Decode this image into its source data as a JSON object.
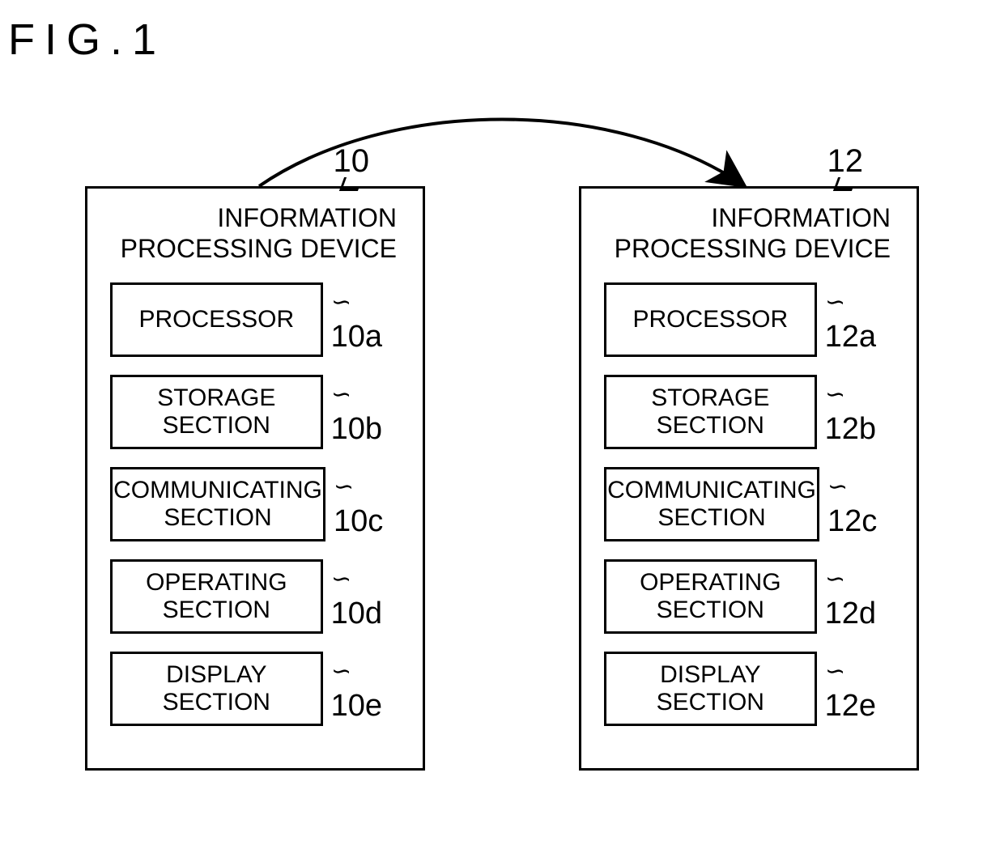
{
  "figure_title": "FIG.1",
  "arrow": {
    "from": "device-10",
    "to": "device-12"
  },
  "devices": [
    {
      "id": "device-10",
      "ref": "10",
      "title_line1": "INFORMATION",
      "title_line2": "PROCESSING DEVICE",
      "components": [
        {
          "label": "PROCESSOR",
          "ref": "10a"
        },
        {
          "label": "STORAGE SECTION",
          "ref": "10b"
        },
        {
          "label": "COMMUNICATING SECTION",
          "ref": "10c"
        },
        {
          "label": "OPERATING SECTION",
          "ref": "10d"
        },
        {
          "label": "DISPLAY SECTION",
          "ref": "10e"
        }
      ]
    },
    {
      "id": "device-12",
      "ref": "12",
      "title_line1": "INFORMATION",
      "title_line2": "PROCESSING DEVICE",
      "components": [
        {
          "label": "PROCESSOR",
          "ref": "12a"
        },
        {
          "label": "STORAGE SECTION",
          "ref": "12b"
        },
        {
          "label": "COMMUNICATING SECTION",
          "ref": "12c"
        },
        {
          "label": "OPERATING SECTION",
          "ref": "12d"
        },
        {
          "label": "DISPLAY SECTION",
          "ref": "12e"
        }
      ]
    }
  ]
}
